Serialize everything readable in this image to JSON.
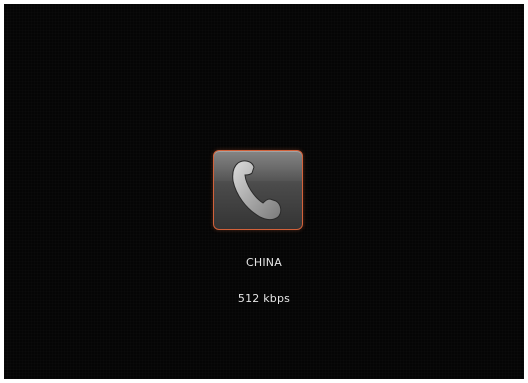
{
  "call": {
    "icon": "phone-handset-icon",
    "caller_name": "CHINA",
    "bitrate": "512 kbps"
  },
  "colors": {
    "background": "#050505",
    "tile_border": "#d2613a",
    "text": "#e6e6e6"
  }
}
